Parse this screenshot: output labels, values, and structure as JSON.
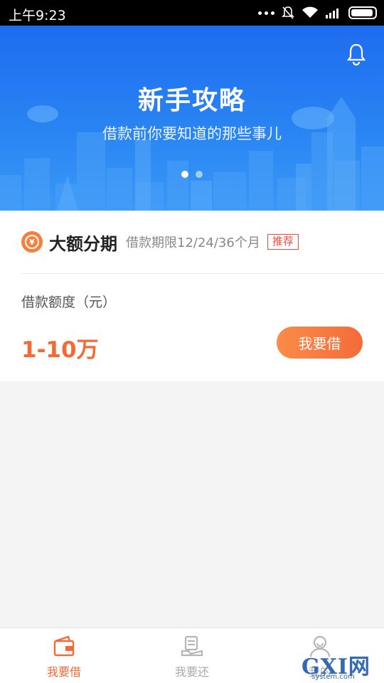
{
  "status_bar": {
    "time": "上午9:23"
  },
  "banner": {
    "title": "新手攻略",
    "subtitle": "借款前你要知道的那些事儿",
    "page_count": 2,
    "active_page": 1
  },
  "product": {
    "name": "大额分期",
    "term": "借款期限12/24/36个月",
    "tag": "推荐",
    "amount_label": "借款额度（元）",
    "amount_value": "1-10万",
    "button_label": "我要借"
  },
  "tabs": [
    {
      "label": "我要借",
      "icon": "wallet-icon",
      "active": true
    },
    {
      "label": "我要还",
      "icon": "repay-icon",
      "active": false
    },
    {
      "label": "我的",
      "icon": "user-icon",
      "active": false
    }
  ],
  "watermark": {
    "text": "GXI网",
    "sub": "system.com"
  },
  "colors": {
    "accent": "#f26a35",
    "banner_blue": "#1e6cf0",
    "tag_red": "#f04c3d"
  }
}
